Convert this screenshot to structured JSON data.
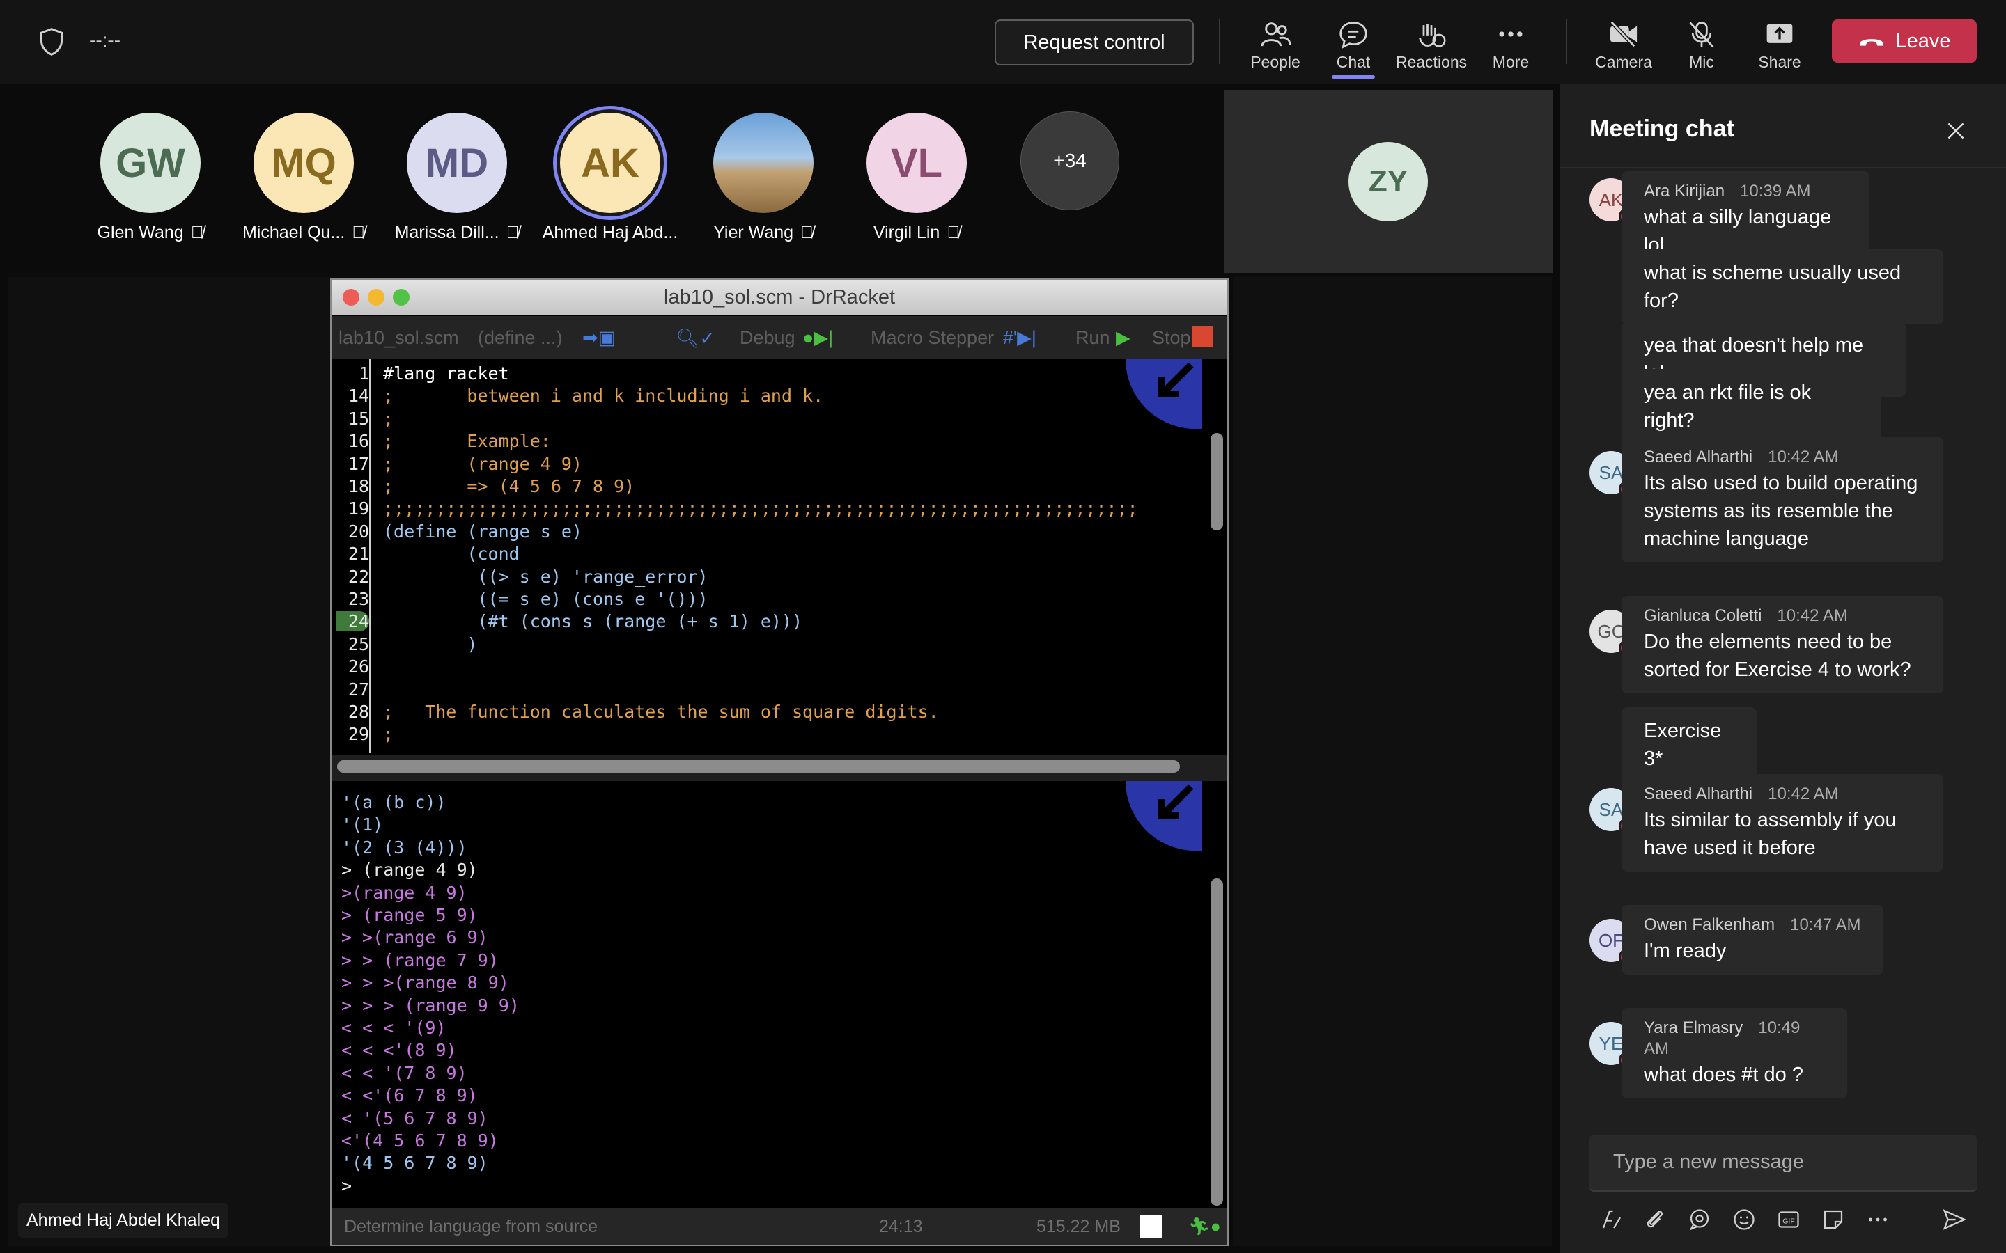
{
  "top_bar": {
    "timer": "--:--",
    "request_control": "Request control",
    "buttons": [
      "People",
      "Chat",
      "Reactions",
      "More",
      "Camera",
      "Mic",
      "Share"
    ],
    "leave": "Leave"
  },
  "participants": [
    {
      "initials": "GW",
      "name": "Glen Wang",
      "bg": "#d8e7dc",
      "fg": "#4b6b52"
    },
    {
      "initials": "MQ",
      "name": "Michael Qu...",
      "bg": "#fbe7b5",
      "fg": "#8a6a1f"
    },
    {
      "initials": "MD",
      "name": "Marissa Dill...",
      "bg": "#dcdcf0",
      "fg": "#5b5b85"
    },
    {
      "initials": "AK",
      "name": "Ahmed Haj Abd...",
      "bg": "#fbe7b5",
      "fg": "#8a6a1f"
    },
    {
      "initials": "",
      "name": "Yier Wang",
      "bg": "#6a8fb8",
      "fg": "#fff"
    },
    {
      "initials": "VL",
      "name": "Virgil Lin",
      "bg": "#f1d5e6",
      "fg": "#8a4d70"
    },
    {
      "initials": "+34",
      "name": "",
      "bg": "#3a3a3a",
      "fg": "#fff"
    }
  ],
  "zy_tile": {
    "initials": "ZY"
  },
  "drracket": {
    "title": "lab10_sol.scm - DrRacket",
    "toolbar": {
      "file": "lab10_sol.scm",
      "define": "(define ...)",
      "debug": "Debug",
      "macro": "Macro Stepper",
      "run": "Run",
      "stop": "Stop"
    },
    "editor_lines": [
      {
        "num": "1",
        "text": "#lang racket",
        "color": "#ffffff"
      },
      {
        "num": "14",
        "text": ";       between i and k including i and k.",
        "color": "#e0a050"
      },
      {
        "num": "15",
        "text": ";",
        "color": "#e0a050"
      },
      {
        "num": "16",
        "text": ";       Example:",
        "color": "#e0a050"
      },
      {
        "num": "17",
        "text": ";       (range 4 9)",
        "color": "#e0a050"
      },
      {
        "num": "18",
        "text": ";       => (4 5 6 7 8 9)",
        "color": "#e0a050"
      },
      {
        "num": "19",
        "text": ";;;;;;;;;;;;;;;;;;;;;;;;;;;;;;;;;;;;;;;;;;;;;;;;;;;;;;;;;;;;;;;;;;;;;;;;",
        "color": "#e0a050"
      },
      {
        "num": "20",
        "text": "(define (range s e)",
        "color": "#9ec8f0"
      },
      {
        "num": "21",
        "text": "        (cond",
        "color": "#9ec8f0"
      },
      {
        "num": "22",
        "text": "         ((> s e) 'range_error)",
        "color": "#9ec8f0"
      },
      {
        "num": "23",
        "text": "         ((= s e) (cons e '()))",
        "color": "#9ec8f0"
      },
      {
        "num": "24",
        "text": "         (#t (cons s (range (+ s 1) e)))",
        "color": "#9ec8f0"
      },
      {
        "num": "25",
        "text": "        )",
        "color": "#9ec8f0"
      },
      {
        "num": "26",
        "text": "",
        "color": "#9ec8f0"
      },
      {
        "num": "27",
        "text": "",
        "color": "#9ec8f0"
      },
      {
        "num": "28",
        "text": ";   The function calculates the sum of square digits.",
        "color": "#e0a050"
      },
      {
        "num": "29",
        "text": ";",
        "color": "#e0a050"
      }
    ],
    "repl_lines": [
      {
        "text": "'(a (b c))",
        "color": "#a0c4f0"
      },
      {
        "text": "'(1)",
        "color": "#a0c4f0"
      },
      {
        "text": "'(2 (3 (4)))",
        "color": "#a0c4f0"
      },
      {
        "text": "> (range 4 9)",
        "color": "#e6e6e6"
      },
      {
        "text": ">(range 4 9)",
        "color": "#c878e0"
      },
      {
        "text": "> (range 5 9)",
        "color": "#c878e0"
      },
      {
        "text": "> >(range 6 9)",
        "color": "#c878e0"
      },
      {
        "text": "> > (range 7 9)",
        "color": "#c878e0"
      },
      {
        "text": "> > >(range 8 9)",
        "color": "#c878e0"
      },
      {
        "text": "> > > (range 9 9)",
        "color": "#c878e0"
      },
      {
        "text": "< < < '(9)",
        "color": "#c878e0"
      },
      {
        "text": "< < <'(8 9)",
        "color": "#c878e0"
      },
      {
        "text": "< < '(7 8 9)",
        "color": "#c878e0"
      },
      {
        "text": "< <'(6 7 8 9)",
        "color": "#c878e0"
      },
      {
        "text": "< '(5 6 7 8 9)",
        "color": "#c878e0"
      },
      {
        "text": "<'(4 5 6 7 8 9)",
        "color": "#c878e0"
      },
      {
        "text": "'(4 5 6 7 8 9)",
        "color": "#a0c4f0"
      },
      {
        "text": ">",
        "color": "#e6e6e6"
      }
    ],
    "status": {
      "language": "Determine language from source",
      "position": "24:13",
      "memory": "515.22 MB"
    }
  },
  "presenter_tag": "Ahmed Haj Abdel Khaleq",
  "chat": {
    "title": "Meeting chat",
    "messages": [
      {
        "initials": "AK",
        "author": "Ara Kirijian",
        "time": "10:39 AM",
        "bubbles": [
          "what a silly language lol",
          "what is scheme usually used for?",
          "yea that doesn't help me lol",
          "yea an rkt file is ok right?"
        ]
      },
      {
        "initials": "SA",
        "author": "Saeed Alharthi",
        "time": "10:42 AM",
        "bubbles": [
          "Its also used to build operating systems as its resemble the machine language"
        ]
      },
      {
        "initials": "GC",
        "author": "Gianluca Coletti",
        "time": "10:42 AM",
        "bubbles": [
          "Do the elements need to be sorted for Exercise 4 to work?",
          "Exercise 3*"
        ]
      },
      {
        "initials": "SA",
        "author": "Saeed Alharthi",
        "time": "10:42 AM",
        "bubbles": [
          "Its similar to assembly if you have used it before"
        ]
      },
      {
        "initials": "OF",
        "author": "Owen Falkenham",
        "time": "10:47 AM",
        "bubbles": [
          "I'm ready"
        ]
      },
      {
        "initials": "YE",
        "author": "Yara Elmasry",
        "time": "10:49 AM",
        "bubbles": [
          "what does #t do ?"
        ]
      }
    ],
    "compose_placeholder": "Type a new message"
  },
  "colors": {
    "accent": "#7f85f5",
    "leave": "#c4314b",
    "panel": "#1f1f1f",
    "bubble": "#292929"
  }
}
